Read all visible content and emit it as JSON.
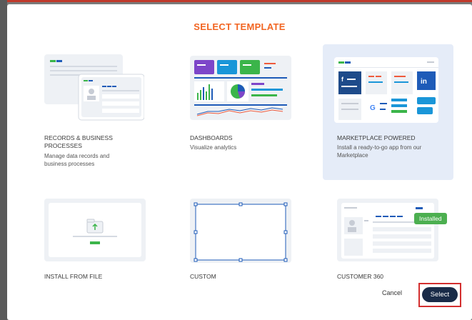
{
  "dialog": {
    "title": "SELECT TEMPLATE",
    "cancel_label": "Cancel",
    "select_label": "Select"
  },
  "templates": [
    {
      "id": "records",
      "title": "RECORDS & BUSINESS PROCESSES",
      "description": "Manage data records and business processes",
      "selected": false
    },
    {
      "id": "dashboards",
      "title": "DASHBOARDS",
      "description": "Visualize analytics",
      "selected": false
    },
    {
      "id": "marketplace",
      "title": "MARKETPLACE POWERED",
      "description": "Install a ready-to-go app from our Marketplace",
      "selected": true
    },
    {
      "id": "install-file",
      "title": "INSTALL FROM FILE",
      "description": "",
      "selected": false
    },
    {
      "id": "custom",
      "title": "CUSTOM",
      "description": "",
      "selected": false
    },
    {
      "id": "customer360",
      "title": "CUSTOMER 360",
      "description": "",
      "selected": false,
      "badge": "Installed"
    }
  ],
  "colors": {
    "accent": "#f26522",
    "selected_bg": "#e5ecf8",
    "primary_button": "#1a2b48",
    "installed": "#4caf50",
    "highlight_border": "#d32f2f"
  }
}
